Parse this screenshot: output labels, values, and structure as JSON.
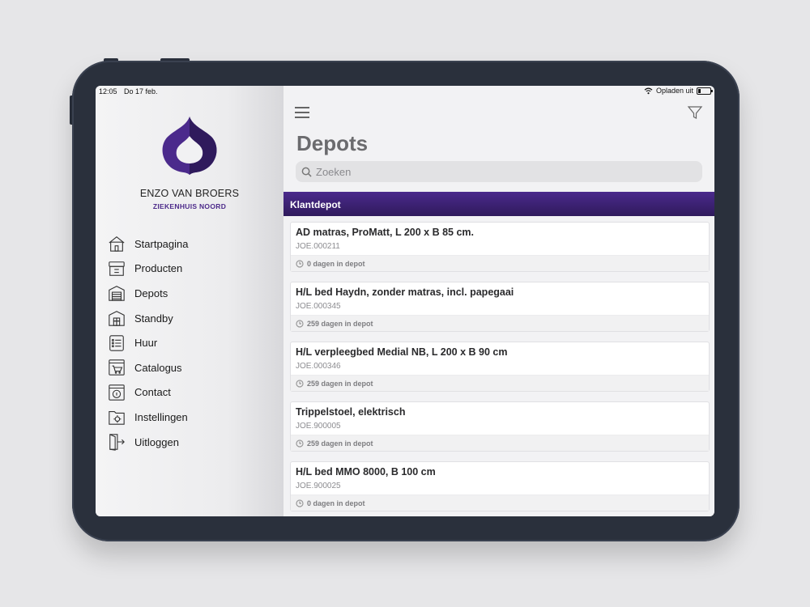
{
  "status_bar": {
    "time": "12:05",
    "date": "Do 17 feb.",
    "charging": "Opladen uit"
  },
  "user": {
    "name": "ENZO VAN BROERS",
    "organization": "ZIEKENHUIS NOORD"
  },
  "colors": {
    "brand_purple": "#4b2a8c",
    "brand_dark": "#2f1a5c"
  },
  "nav": [
    {
      "label": "Startpagina",
      "icon": "home-icon"
    },
    {
      "label": "Producten",
      "icon": "products-icon"
    },
    {
      "label": "Depots",
      "icon": "depot-icon"
    },
    {
      "label": "Standby",
      "icon": "standby-icon"
    },
    {
      "label": "Huur",
      "icon": "rental-list-icon"
    },
    {
      "label": "Catalogus",
      "icon": "catalog-cart-icon"
    },
    {
      "label": "Contact",
      "icon": "contact-icon"
    },
    {
      "label": "Instellingen",
      "icon": "settings-folder-icon"
    },
    {
      "label": "Uitloggen",
      "icon": "logout-icon"
    }
  ],
  "main": {
    "title": "Depots",
    "search_placeholder": "Zoeken",
    "section": "Klantdepot",
    "items": [
      {
        "title": "AD matras, ProMatt, L 200 x B 85 cm.",
        "code": "JOE.000211",
        "days": "0 dagen in depot"
      },
      {
        "title": "H/L bed Haydn, zonder matras, incl. papegaai",
        "code": "JOE.000345",
        "days": "259 dagen in depot"
      },
      {
        "title": "H/L verpleegbed Medial NB, L 200 x B 90 cm",
        "code": "JOE.000346",
        "days": "259 dagen in depot"
      },
      {
        "title": "Trippelstoel, elektrisch",
        "code": "JOE.900005",
        "days": "259 dagen in depot"
      },
      {
        "title": "H/L bed MMO 8000, B 100 cm",
        "code": "JOE.900025",
        "days": "0 dagen in depot"
      }
    ]
  }
}
